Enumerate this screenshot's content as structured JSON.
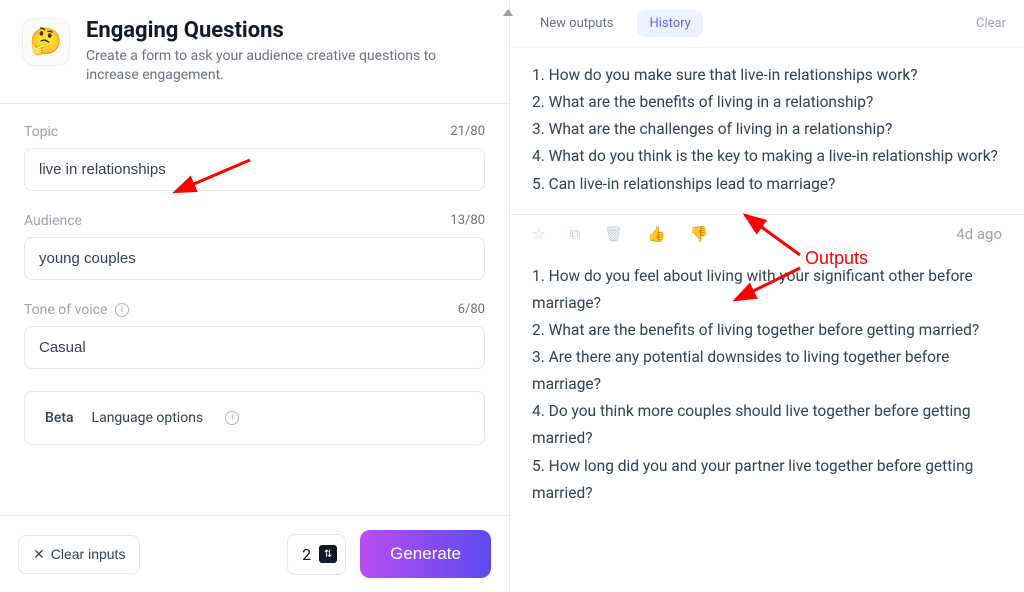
{
  "header": {
    "icon": "🤔",
    "title": "Engaging Questions",
    "description": "Create a form to ask your audience creative questions to increase engagement."
  },
  "form": {
    "topic": {
      "label": "Topic",
      "value": "live in relationships",
      "count": "21/80"
    },
    "audience": {
      "label": "Audience",
      "value": "young couples",
      "count": "13/80"
    },
    "tone": {
      "label": "Tone of voice",
      "value": "Casual",
      "count": "6/80"
    },
    "language": {
      "beta": "Beta",
      "label": "Language options"
    }
  },
  "footer": {
    "clear": "Clear inputs",
    "qty": "2",
    "generate": "Generate"
  },
  "tabs": {
    "new": "New outputs",
    "history": "History",
    "clear": "Clear"
  },
  "outputs": [
    {
      "lines": [
        "1. How do you make sure that live-in relationships work?",
        "2. What are the benefits of living in a relationship?",
        "3. What are the challenges of living in a relationship?",
        "4. What do you think is the key to making a live-in relationship work?",
        "5. Can live-in relationships lead to marriage?"
      ],
      "time": "4d ago"
    },
    {
      "lines": [
        "1. How do you feel about living with your significant other before marriage?",
        "2. What are the benefits of living together before getting married?",
        "3. Are there any potential downsides to living together before marriage?",
        "4. Do you think more couples should live together before getting married?",
        "5. How long did you and your partner live together before getting married?"
      ]
    }
  ],
  "annotation": {
    "label": "Outputs"
  }
}
